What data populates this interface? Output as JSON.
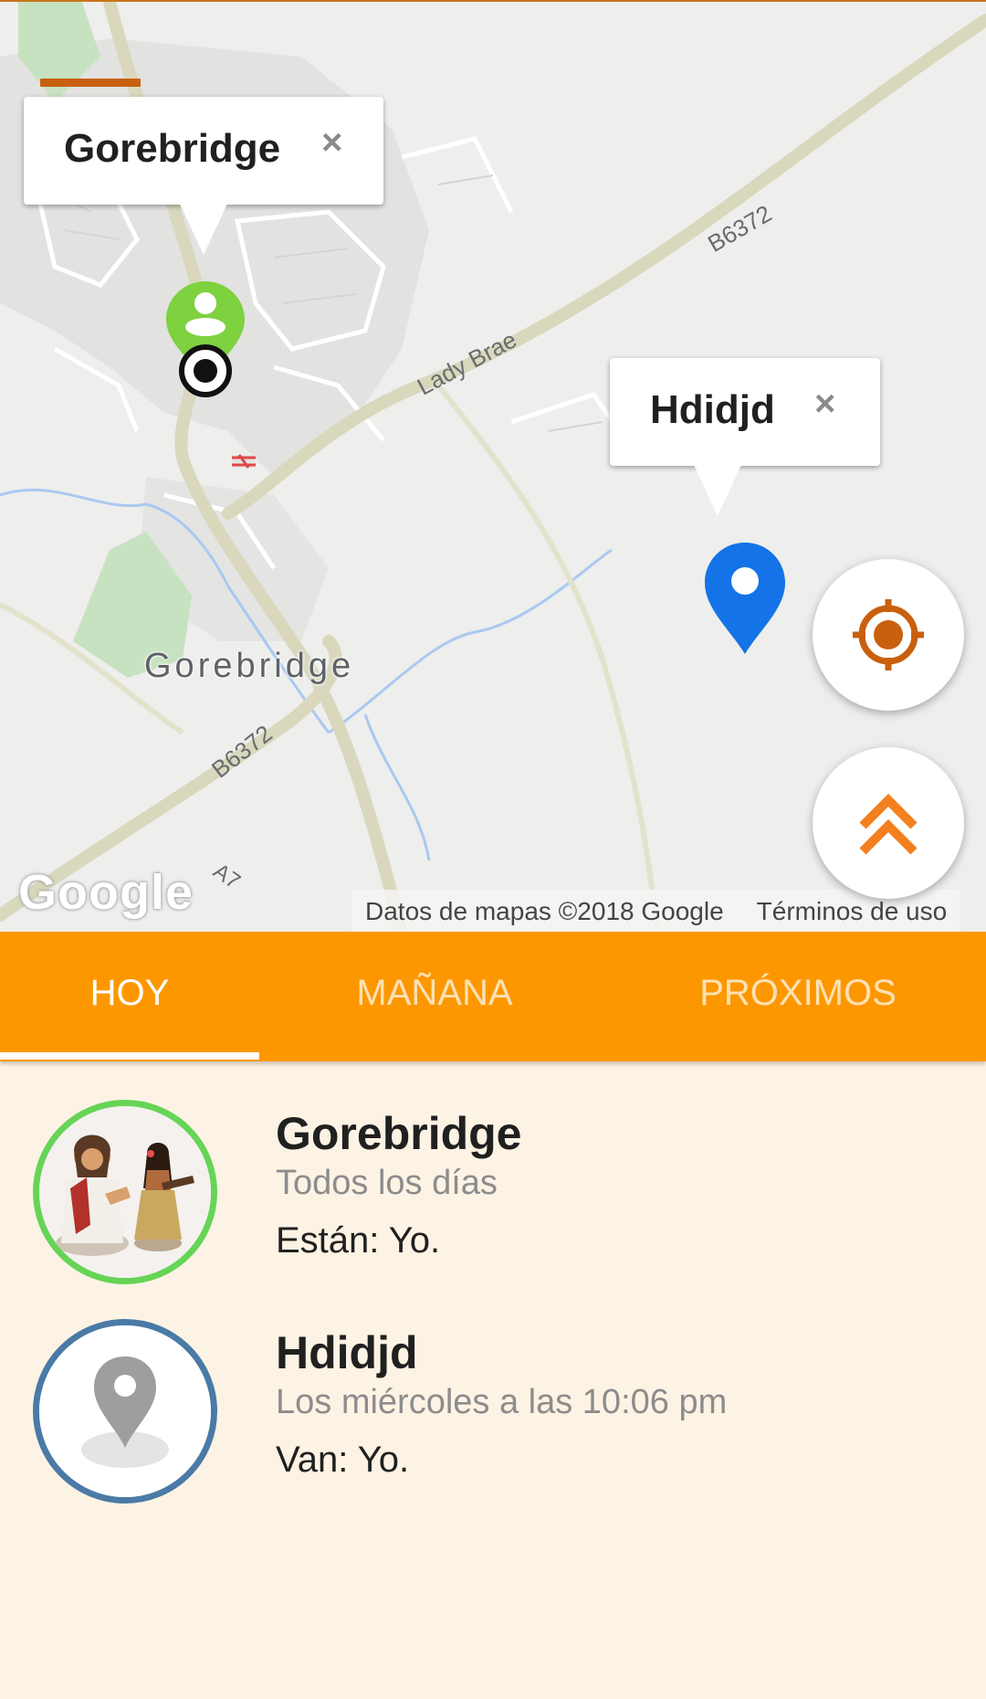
{
  "map": {
    "place_label": "Gorebridge",
    "road_labels": [
      "Lady Brae",
      "B6372",
      "B6372",
      "A7"
    ],
    "google_logo": "Google",
    "attribution_data": "Datos de mapas ©2018 Google",
    "attribution_terms": "Términos de uso",
    "info_windows": [
      {
        "title": "Gorebridge",
        "close": "×"
      },
      {
        "title": "Hdidjd",
        "close": "×"
      }
    ],
    "colors": {
      "user_marker": "#7ed13f",
      "place_marker": "#1473e6",
      "accent": "#c8600e"
    }
  },
  "menu_icon": "hamburger-icon",
  "fabs": {
    "locate_icon": "my-location-icon",
    "expand_icon": "double-chevron-up-icon"
  },
  "tabs": [
    {
      "label": "HOY",
      "active": true
    },
    {
      "label": "MAÑANA",
      "active": false
    },
    {
      "label": "PRÓXIMOS",
      "active": false
    }
  ],
  "list": [
    {
      "title": "Gorebridge",
      "schedule": "Todos los días",
      "who": "Están: Yo.",
      "avatar": "photo-figurines",
      "ring_color": "#66d456"
    },
    {
      "title": "Hdidjd",
      "schedule": "Los miércoles a las 10:06 pm",
      "who": "Van: Yo.",
      "avatar": "place-pin-icon",
      "ring_color": "#4a7aa6"
    }
  ],
  "colors": {
    "tab_bar": "#fd9700",
    "background": "#fdf3e4"
  }
}
